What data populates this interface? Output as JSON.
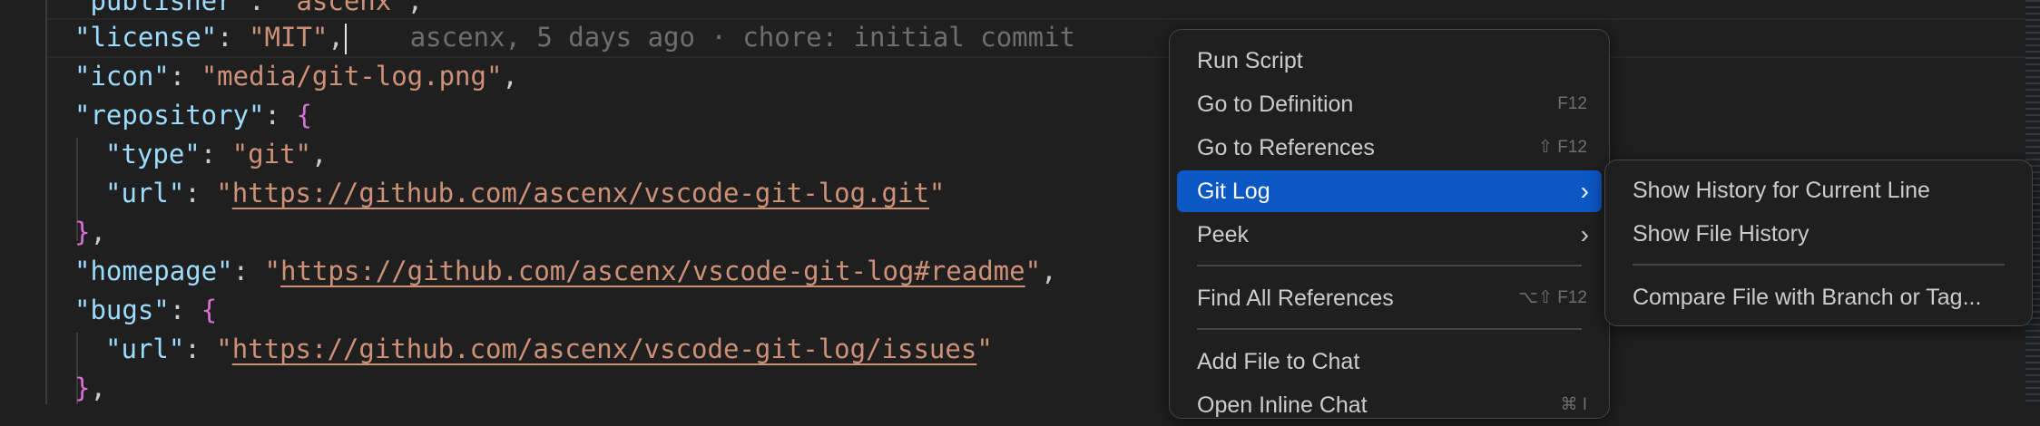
{
  "editor": {
    "blame": "ascenx, 5 days ago · chore: initial commit",
    "lines": {
      "publisher_key": "\"publisher\"",
      "publisher_value": "\"ascenx\"",
      "license_key": "\"license\"",
      "license_value": "\"MIT\"",
      "icon_key": "\"icon\"",
      "icon_value": "\"media/git-log.png\"",
      "repository_key": "\"repository\"",
      "type_key": "\"type\"",
      "type_value": "\"git\"",
      "url_key": "\"url\"",
      "repo_url": "https://github.com/ascenx/vscode-git-log.git",
      "homepage_key": "\"homepage\"",
      "homepage_url": "https://github.com/ascenx/vscode-git-log#readme",
      "bugs_key": "\"bugs\"",
      "bugs_url_key": "\"url\"",
      "bugs_url": "https://github.com/ascenx/vscode-git-log/issues"
    }
  },
  "context_menu": {
    "items": [
      {
        "label": "Run Script",
        "shortcut": ""
      },
      {
        "label": "Go to Definition",
        "shortcut": "F12"
      },
      {
        "label": "Go to References",
        "shortcut": "⇧ F12"
      },
      {
        "label": "Git Log",
        "shortcut": "",
        "has_submenu": true,
        "active": true
      },
      {
        "label": "Peek",
        "shortcut": "",
        "has_submenu": true
      },
      {
        "label": "Find All References",
        "shortcut": "⌥⇧ F12"
      },
      {
        "label": "Add File to Chat",
        "shortcut": ""
      },
      {
        "label": "Open Inline Chat",
        "shortcut": "⌘ I"
      }
    ],
    "chevron": "›"
  },
  "submenu": {
    "items": [
      {
        "label": "Show History for Current Line"
      },
      {
        "label": "Show File History"
      },
      {
        "label": "Compare File with Branch or Tag..."
      }
    ]
  },
  "colors": {
    "background": "#1f1f1f",
    "active_item": "#0b57c4",
    "json_key": "#9cdcfe",
    "json_string": "#ce9178",
    "bracket": "#da70d6",
    "blame": "#6e6e6e"
  }
}
